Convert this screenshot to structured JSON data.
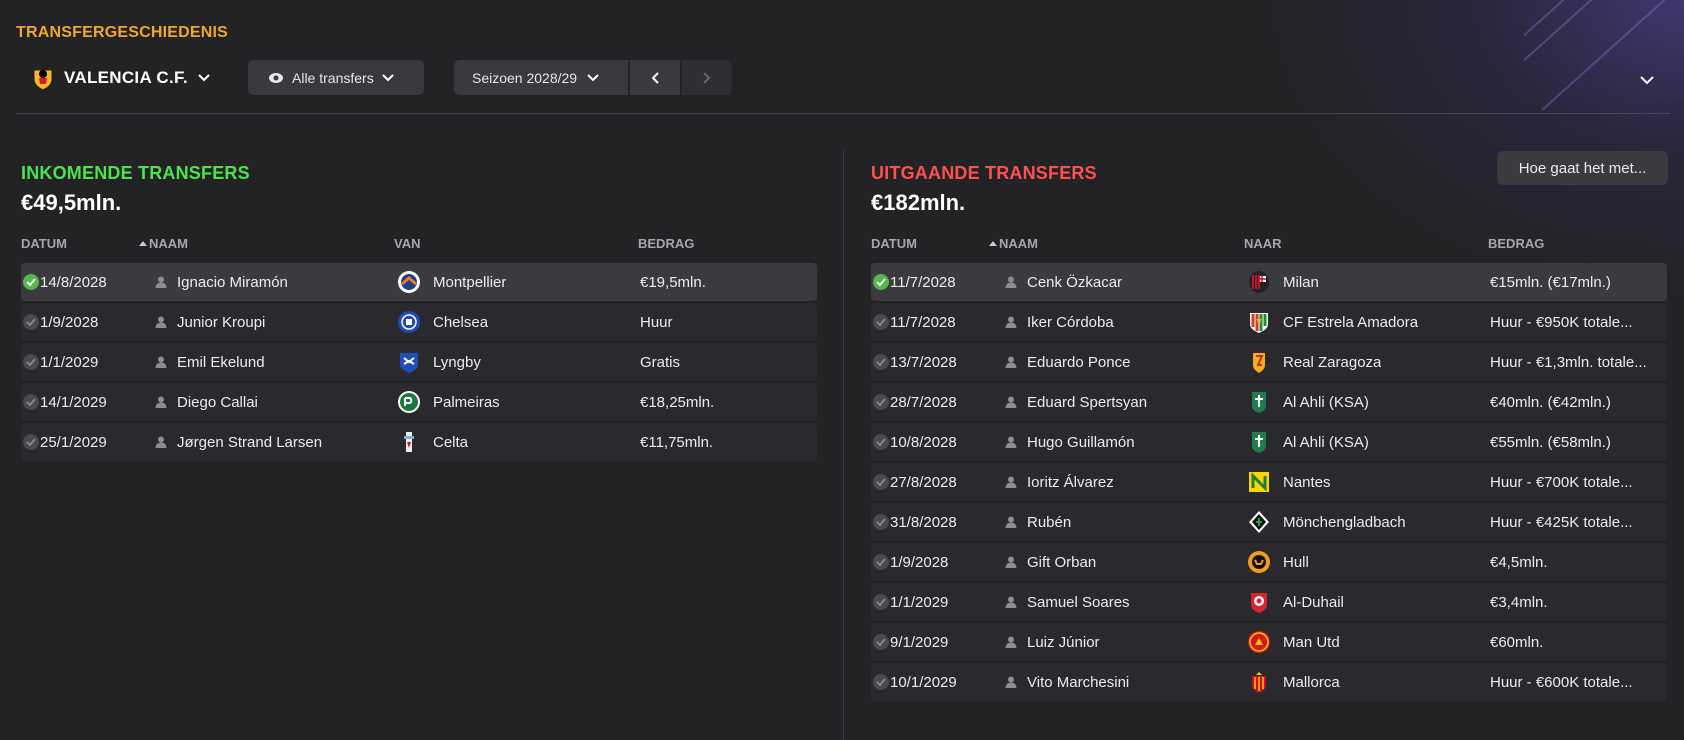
{
  "header": {
    "title": "TRANSFERGESCHIEDENIS",
    "club": "VALENCIA C.F.",
    "filter": "Alle transfers",
    "season": "Seizoen 2028/29"
  },
  "incoming": {
    "title": "INKOMENDE TRANSFERS",
    "total": "€49,5mln.",
    "columns": [
      "DATUM",
      "NAAM",
      "VAN",
      "BEDRAG"
    ],
    "rows": [
      {
        "date": "14/8/2028",
        "name": "Ignacio Miramón",
        "club": "Montpellier",
        "amount": "€19,5mln.",
        "crest": "montpellier-crest-icon",
        "selected": true
      },
      {
        "date": "1/9/2028",
        "name": "Junior Kroupi",
        "club": "Chelsea",
        "amount": "Huur",
        "crest": "chelsea-crest-icon",
        "selected": false
      },
      {
        "date": "1/1/2029",
        "name": "Emil Ekelund",
        "club": "Lyngby",
        "amount": "Gratis",
        "crest": "lyngby-crest-icon",
        "selected": false
      },
      {
        "date": "14/1/2029",
        "name": "Diego Callai",
        "club": "Palmeiras",
        "amount": "€18,25mln.",
        "crest": "palmeiras-crest-icon",
        "selected": false
      },
      {
        "date": "25/1/2029",
        "name": "Jørgen Strand Larsen",
        "club": "Celta",
        "amount": "€11,75mln.",
        "crest": "celta-crest-icon",
        "selected": false
      }
    ]
  },
  "outgoing": {
    "title": "UITGAANDE TRANSFERS",
    "total": "€182mln.",
    "help_button": "Hoe gaat het met...",
    "columns": [
      "DATUM",
      "NAAM",
      "NAAR",
      "BEDRAG"
    ],
    "rows": [
      {
        "date": "11/7/2028",
        "name": "Cenk Özkacar",
        "club": "Milan",
        "amount": "€15mln. (€17mln.)",
        "crest": "milan-crest-icon",
        "selected": true
      },
      {
        "date": "11/7/2028",
        "name": "Iker Córdoba",
        "club": "CF Estrela Amadora",
        "amount": "Huur - €950K totale...",
        "crest": "estrela-amadora-crest-icon",
        "selected": false
      },
      {
        "date": "13/7/2028",
        "name": "Eduardo Ponce",
        "club": "Real Zaragoza",
        "amount": "Huur - €1,3mln. totale...",
        "crest": "zaragoza-crest-icon",
        "selected": false
      },
      {
        "date": "28/7/2028",
        "name": "Eduard Spertsyan",
        "club": "Al Ahli (KSA)",
        "amount": "€40mln. (€42mln.)",
        "crest": "al-ahli-crest-icon",
        "selected": false
      },
      {
        "date": "10/8/2028",
        "name": "Hugo Guillamón",
        "club": "Al Ahli (KSA)",
        "amount": "€55mln. (€58mln.)",
        "crest": "al-ahli-crest-icon",
        "selected": false
      },
      {
        "date": "27/8/2028",
        "name": "Ioritz Álvarez",
        "club": "Nantes",
        "amount": "Huur - €700K totale...",
        "crest": "nantes-crest-icon",
        "selected": false
      },
      {
        "date": "31/8/2028",
        "name": "Rubén",
        "club": "Mönchengladbach",
        "amount": "Huur - €425K totale...",
        "crest": "monchengladbach-crest-icon",
        "selected": false
      },
      {
        "date": "1/9/2028",
        "name": "Gift Orban",
        "club": "Hull",
        "amount": "€4,5mln.",
        "crest": "hull-crest-icon",
        "selected": false
      },
      {
        "date": "1/1/2029",
        "name": "Samuel Soares",
        "club": "Al-Duhail",
        "amount": "€3,4mln.",
        "crest": "al-duhail-crest-icon",
        "selected": false
      },
      {
        "date": "9/1/2029",
        "name": "Luiz Júnior",
        "club": "Man Utd",
        "amount": "€60mln.",
        "crest": "man-utd-crest-icon",
        "selected": false
      },
      {
        "date": "10/1/2029",
        "name": "Vito Marchesini",
        "club": "Mallorca",
        "amount": "Huur - €600K totale...",
        "crest": "mallorca-crest-icon",
        "selected": false
      }
    ]
  },
  "colors": {
    "title": "#f0a72e",
    "incoming": "#4ee24e",
    "outgoing": "#ff4f4f",
    "check_on": "#54b84d"
  }
}
